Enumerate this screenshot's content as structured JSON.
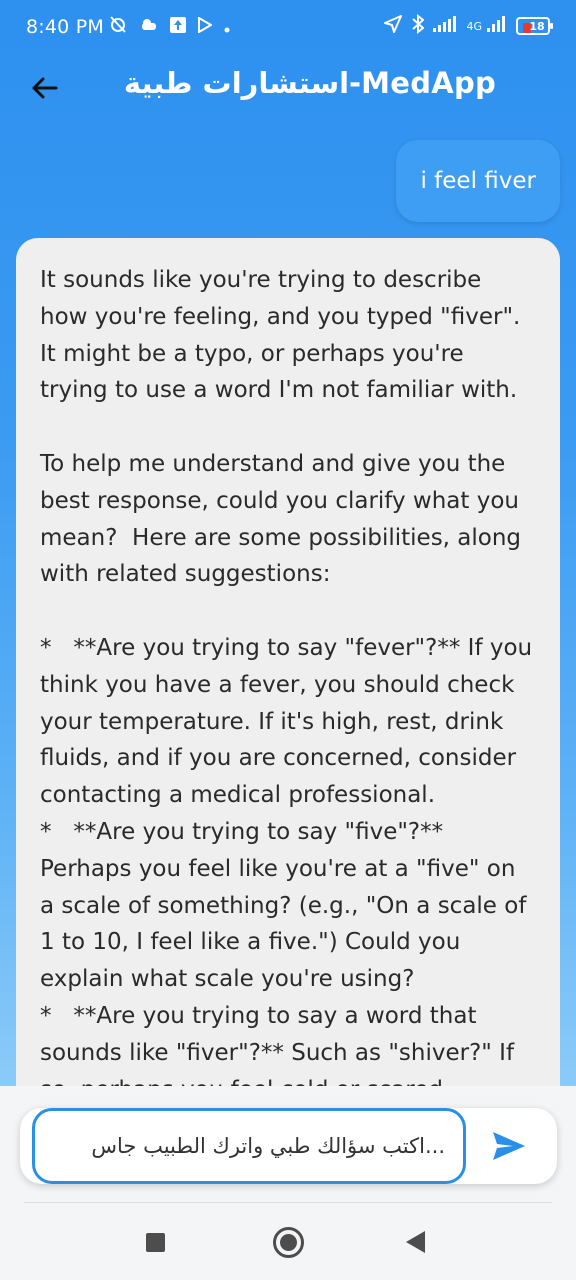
{
  "status_bar": {
    "time": "8:40 PM",
    "network_label": "4G",
    "battery_level": "18",
    "battery_color": "#e53935"
  },
  "app_bar": {
    "title": "استشارات طبية-MedApp",
    "back_icon": "arrow-left-icon"
  },
  "messages": {
    "user_text": "i feel fiver",
    "bot_text": "It sounds like you're trying to describe how you're feeling, and you typed \"fiver\". It might be a typo, or perhaps you're trying to use a word I'm not familiar with.\n\nTo help me understand and give you the best response, could you clarify what you mean?  Here are some possibilities, along with related suggestions:\n\n*   **Are you trying to say \"fever\"?** If you think you have a fever, you should check your temperature. If it's high, rest, drink fluids, and if you are concerned, consider contacting a medical professional.\n*   **Are you trying to say \"five\"?** Perhaps you feel like you're at a \"five\" on a scale of something? (e.g., \"On a scale of 1 to 10, I feel like a five.\") Could you explain what scale you're using?\n*   **Are you trying to say a word that sounds like \"fiver\"?** Such as \"shiver?\" If so, perhaps you feel cold or scared."
  },
  "composer": {
    "placeholder": "...اكتب سؤالك طبي واترك الطبيب جاس",
    "send_icon": "send-icon"
  },
  "colors": {
    "accent": "#2e90ef",
    "user_bubble": "#3d9ef4",
    "bot_bubble": "#efefef"
  }
}
